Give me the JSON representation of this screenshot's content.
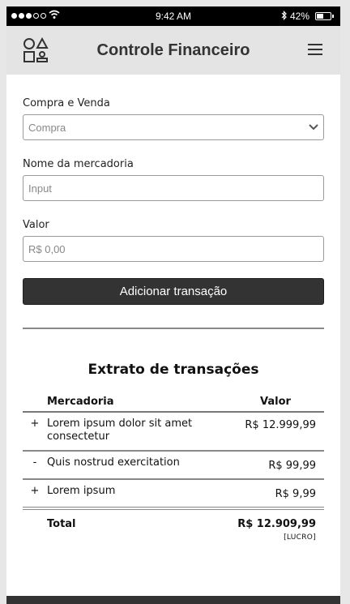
{
  "status": {
    "time": "9:42 AM",
    "battery": "42%",
    "battery_level": 0.42,
    "bluetooth_icon": "bluetooth-icon",
    "wifi_icon": "wifi-icon"
  },
  "header": {
    "title": "Controle Financeiro",
    "logo_icon": "shapes-icon",
    "menu_icon": "hamburger-menu-icon"
  },
  "form": {
    "type_label": "Compra e Venda",
    "type_value": "Compra",
    "name_label": "Nome da mercadoria",
    "name_placeholder": "Input",
    "value_label": "Valor",
    "value_placeholder": "R$ 0,00",
    "submit_label": "Adicionar transação"
  },
  "statement": {
    "title": "Extrato de transações",
    "columns": {
      "item": "Mercadoria",
      "value": "Valor"
    },
    "rows": [
      {
        "sign": "+",
        "name": "Lorem ipsum dolor sit amet consectetur",
        "value": "R$ 12.999,99"
      },
      {
        "sign": "-",
        "name": "Quis nostrud exercitation",
        "value": "R$ 99,99"
      },
      {
        "sign": "+",
        "name": "Lorem ipsum",
        "value": "R$ 9,99"
      }
    ],
    "total_label": "Total",
    "total_value": "R$ 12.909,99",
    "total_status": "[LUCRO]"
  },
  "colors": {
    "header_bg": "#e4e4e4",
    "button_bg": "#333333",
    "page_bg": "#e7e7e7"
  }
}
